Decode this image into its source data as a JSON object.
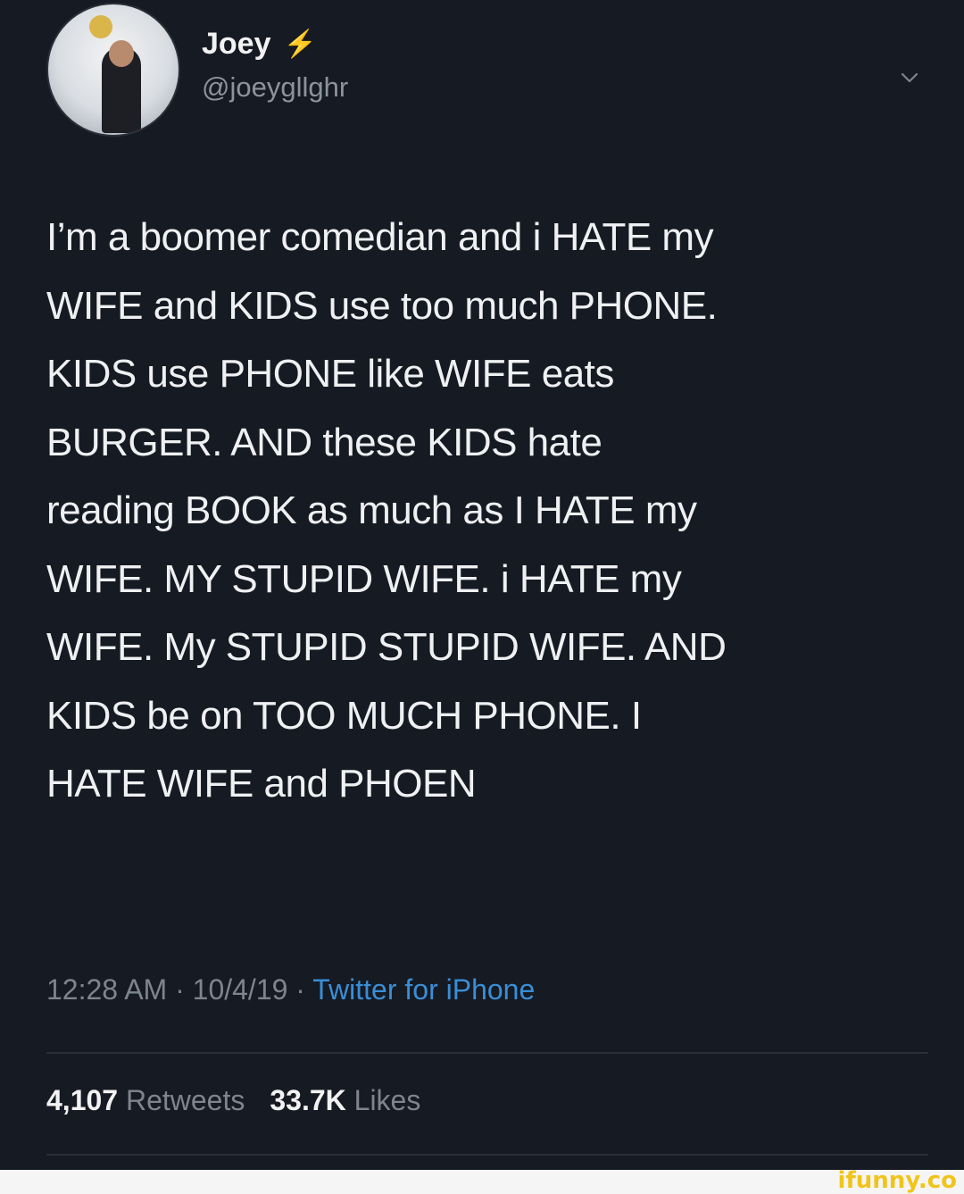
{
  "user": {
    "display_name": "Joey",
    "badge_icon": "lightning-bolt-icon",
    "handle": "@joeygllghr"
  },
  "tweet": {
    "text": "I’m a boomer comedian and i HATE my\nWIFE and KIDS use too much PHONE.\nKIDS use PHONE like WIFE eats\nBURGER. AND these KIDS hate\nreading BOOK as much as I HATE my\nWIFE. MY STUPID WIFE. i HATE my\nWIFE. My STUPID STUPID WIFE. AND\nKIDS be on TOO MUCH PHONE. I\nHATE WIFE and PHOEN",
    "time": "12:28 AM",
    "date": "10/4/19",
    "separator": " · ",
    "source": "Twitter for iPhone"
  },
  "stats": {
    "retweets_count": "4,107",
    "retweets_label": "Retweets",
    "likes_count": "33.7K",
    "likes_label": "Likes"
  },
  "watermark": {
    "text": "ifunny.co"
  },
  "colors": {
    "background": "#161a22",
    "link": "#3a8ed6",
    "badge": "#e0b63c",
    "watermark": "#f0c419"
  }
}
